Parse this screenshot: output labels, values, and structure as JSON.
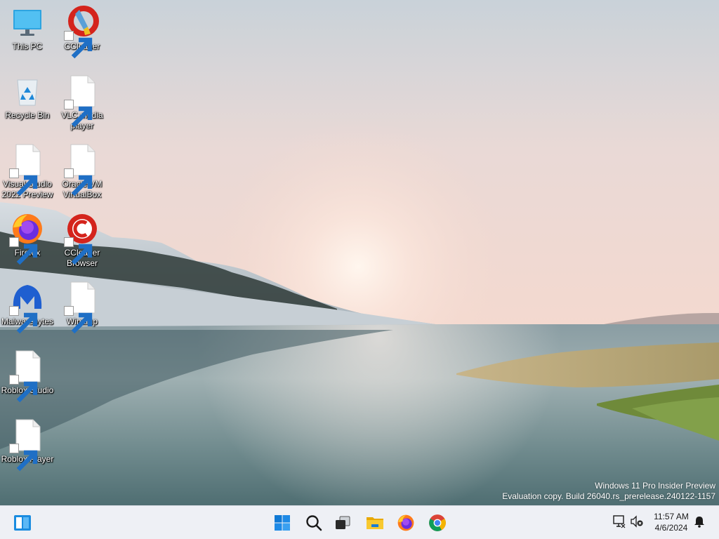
{
  "desktop": {
    "icons": [
      {
        "label": "This PC",
        "icon": "this-pc-icon"
      },
      {
        "label": "CCleaner",
        "icon": "ccleaner-icon"
      },
      {
        "label": "Recycle Bin",
        "icon": "recycle-bin-icon"
      },
      {
        "label": "VLC media player",
        "icon": "blank-file-icon"
      },
      {
        "label": "Visual Studio 2022 Preview",
        "icon": "blank-file-icon"
      },
      {
        "label": "Oracle VM VirtualBox",
        "icon": "blank-file-icon"
      },
      {
        "label": "Firefox",
        "icon": "firefox-icon"
      },
      {
        "label": "CCleaner Browser",
        "icon": "ccleaner-browser-icon"
      },
      {
        "label": "Malwarebytes",
        "icon": "malwarebytes-icon"
      },
      {
        "label": "Winamp",
        "icon": "blank-file-icon"
      },
      {
        "label": "Roblox Studio",
        "icon": "blank-file-icon"
      },
      {
        "label": "Roblox Player",
        "icon": "blank-file-icon"
      }
    ]
  },
  "watermark": {
    "line1": "Windows 11 Pro Insider Preview",
    "line2": "Evaluation copy. Build 26040.rs_prerelease.240122-1157"
  },
  "taskbar": {
    "left": {
      "icon": "widgets-icon"
    },
    "center": [
      {
        "icon": "start-windows-icon"
      },
      {
        "icon": "search-icon"
      },
      {
        "icon": "task-view-icon"
      },
      {
        "icon": "file-explorer-icon"
      },
      {
        "icon": "firefox-icon"
      },
      {
        "icon": "chrome-icon"
      }
    ],
    "tray": [
      {
        "icon": "network-icon"
      },
      {
        "icon": "volume-muted-icon"
      },
      {
        "icon": "notification-bell-icon"
      }
    ],
    "clock": {
      "time": "11:57 AM",
      "date": "4/6/2024"
    }
  },
  "colors": {
    "accent": "#0078d4",
    "taskbar_bg": "#eef0f5"
  }
}
